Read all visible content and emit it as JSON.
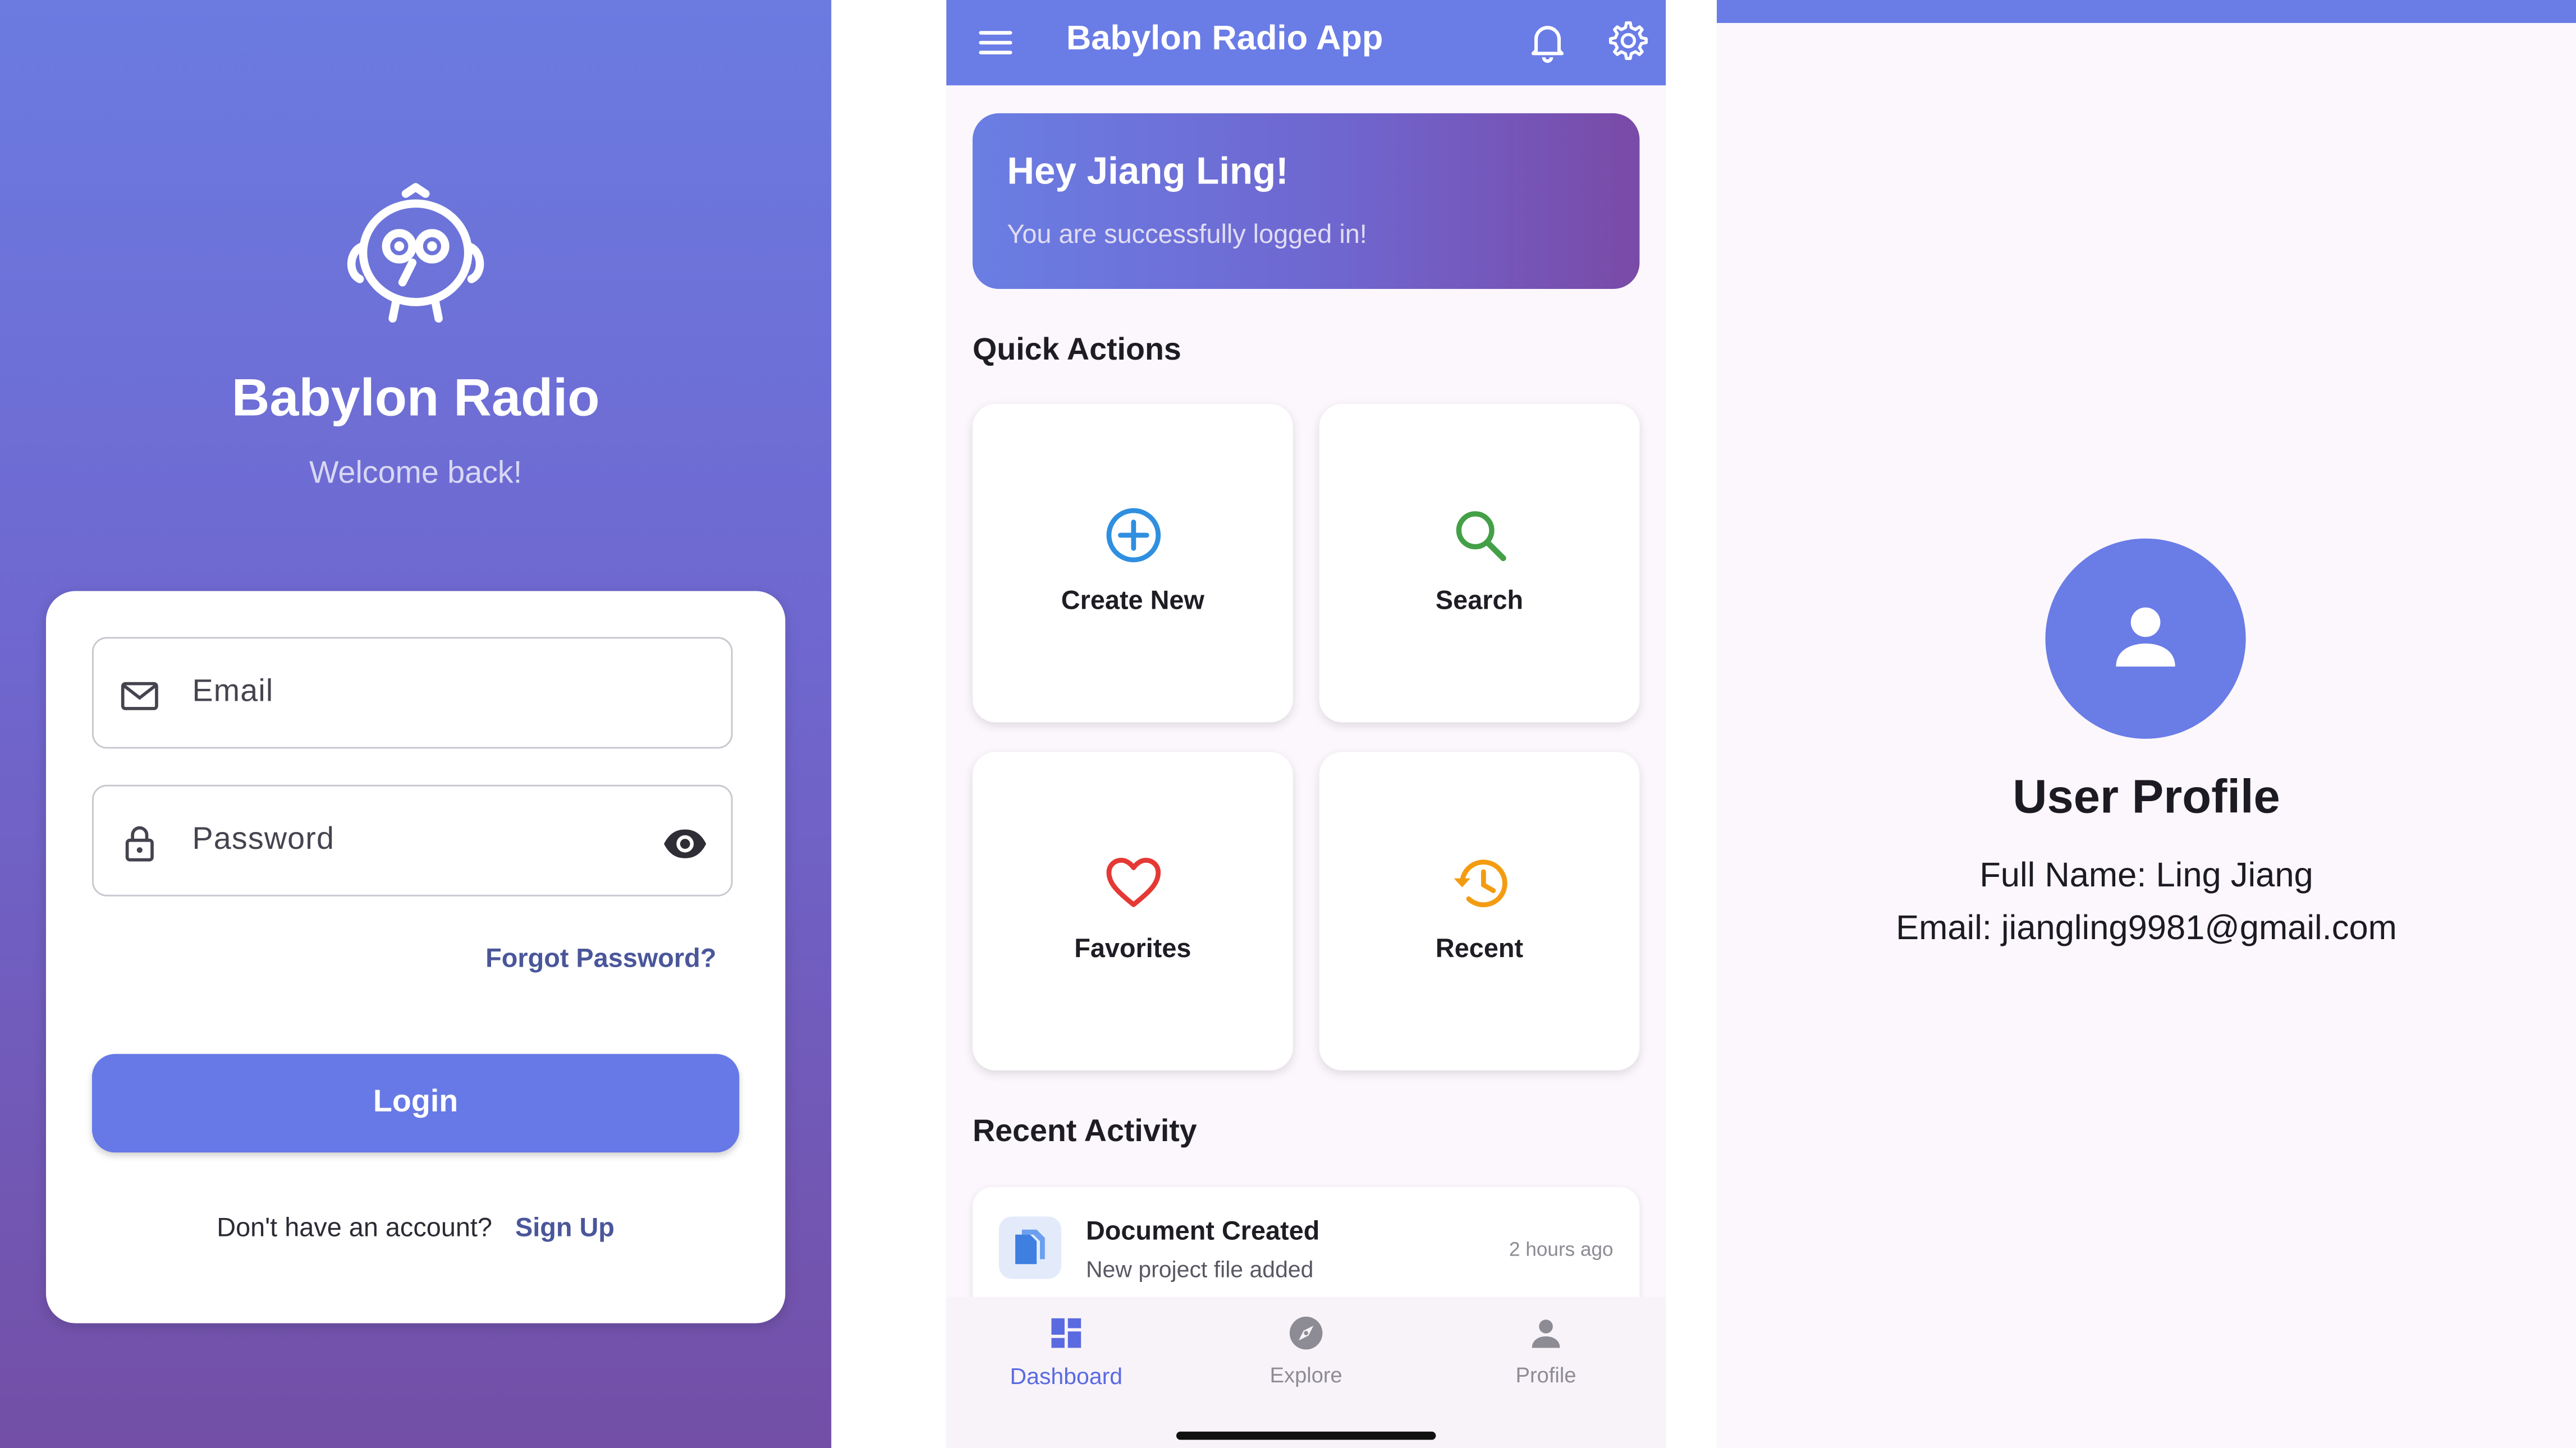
{
  "login": {
    "app_name": "Babylon Radio",
    "subtitle": "Welcome back!",
    "email_placeholder": "Email",
    "password_placeholder": "Password",
    "forgot_password": "Forgot Password?",
    "login_button": "Login",
    "no_account": "Don't have an account?",
    "sign_up": "Sign Up"
  },
  "dashboard": {
    "app_bar_title": "Babylon Radio App",
    "greeting": "Hey Jiang Ling!",
    "greeting_sub": "You are successfully logged in!",
    "quick_actions_title": "Quick Actions",
    "quick_actions": [
      {
        "label": "Create New",
        "icon": "add-circle-icon",
        "color": "#2f8fe0"
      },
      {
        "label": "Search",
        "icon": "search-icon",
        "color": "#43a047"
      },
      {
        "label": "Favorites",
        "icon": "heart-icon",
        "color": "#e53935"
      },
      {
        "label": "Recent",
        "icon": "history-icon",
        "color": "#f39c12"
      }
    ],
    "recent_activity_title": "Recent Activity",
    "activity": {
      "title": "Document Created",
      "subtitle": "New project file added",
      "time": "2 hours ago"
    },
    "bottom_nav": [
      {
        "label": "Dashboard",
        "icon": "dashboard-icon",
        "active": true
      },
      {
        "label": "Explore",
        "icon": "compass-icon",
        "active": false
      },
      {
        "label": "Profile",
        "icon": "person-icon",
        "active": false
      }
    ]
  },
  "profile": {
    "title": "User Profile",
    "full_name": "Full Name: Ling Jiang",
    "email": "Email: jiangling9981@gmail.com"
  },
  "colors": {
    "primary": "#6a7ce6",
    "accent_text": "#4a569a",
    "background": "#fbf7fc"
  }
}
